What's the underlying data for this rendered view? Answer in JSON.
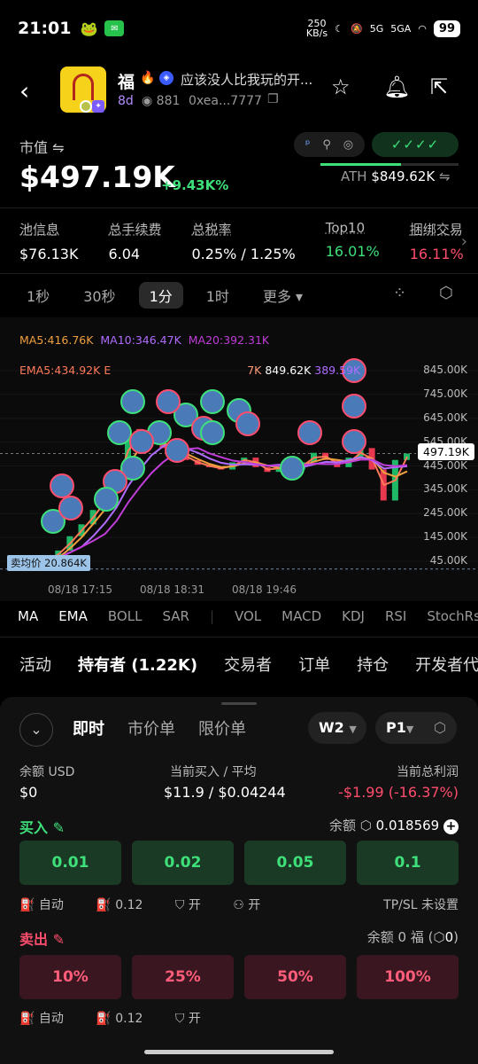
{
  "status": {
    "time": "21:01",
    "net_speed_top": "250",
    "net_speed_unit": "KB/s",
    "signal1": "5G",
    "signal2": "5GA",
    "battery": "99"
  },
  "token": {
    "name": "福",
    "description": "应该没人比我玩的开...",
    "age": "8d",
    "views": "881",
    "address": "0xea...7777"
  },
  "market": {
    "label": "市值",
    "value": "$497.19K",
    "change": "+9.43K%",
    "ath_label": "ATH",
    "ath_value": "$849.62K",
    "ath_progress": 0.585,
    "checks": "✓✓✓✓"
  },
  "stats": [
    {
      "label": "池信息",
      "value": "$76.13K",
      "color": "#ffffff"
    },
    {
      "label": "总手续费",
      "value": "6.04",
      "color": "#ffffff"
    },
    {
      "label": "总税率",
      "value": "0.25% / 1.25%",
      "color": "#ffffff"
    },
    {
      "label": "Top10",
      "value": "16.01%",
      "color": "#3ee07a"
    },
    {
      "label": "捆绑交易",
      "value": "16.11%",
      "color": "#ff4d6d"
    }
  ],
  "timeframes": [
    "1秒",
    "30秒",
    "1分",
    "1时",
    "更多"
  ],
  "active_timeframe": "1分",
  "chart_data": {
    "type": "line",
    "ma_legend": {
      "ma5": "MA5:416.76K",
      "ma10": "MA10:346.47K",
      "ma20": "MA20:392.31K"
    },
    "ema_legend": {
      "ema5": "EMA5:434.92K",
      "ema_rest": "E",
      "ath_marker": "849.62K",
      "ema20": "389.59K",
      "ema_mid": "7K"
    },
    "y_ticks": [
      "845.00K",
      "745.00K",
      "645.00K",
      "545.00K",
      "445.00K",
      "345.00K",
      "245.00K",
      "145.00K",
      "45.00K"
    ],
    "x_ticks": [
      "08/18 17:15",
      "08/18 18:31",
      "08/18 19:46"
    ],
    "sell_avg": "卖均价 20.864K",
    "current_price": "497.19K",
    "price_series": [
      30,
      60,
      90,
      150,
      200,
      260,
      330,
      420,
      600,
      540,
      560,
      520,
      500,
      470,
      450,
      440,
      430,
      460,
      480,
      440,
      420,
      450,
      430,
      460,
      500,
      470,
      440,
      480,
      520,
      430,
      300,
      470,
      497
    ],
    "colors": {
      "ma5": "#f0a040",
      "ma10": "#b06cff",
      "ma20": "#c03dd8",
      "ema5": "#ff7a59"
    }
  },
  "indicators": [
    "MA",
    "EMA",
    "BOLL",
    "SAR",
    "VOL",
    "MACD",
    "KDJ",
    "RSI",
    "StochRsi"
  ],
  "tabs": [
    "活动",
    "持有者 (1.22K)",
    "交易者",
    "订单",
    "持仓",
    "开发者代币"
  ],
  "order": {
    "tabs": [
      "即时",
      "市价单",
      "限价单"
    ],
    "wallet": "W2",
    "preset": "P1",
    "balance_label": "余额 USD",
    "balance_value": "$0",
    "current_buy_label": "当前买入 / 平均",
    "current_buy_value": "$11.9 / $0.04244",
    "pnl_label": "当前总利润",
    "pnl_value": "-$1.99 (-16.37%)",
    "buy_label": "买入",
    "buy_balance_label": "余额",
    "buy_balance_value": "0.018569",
    "buy_amounts": [
      "0.01",
      "0.02",
      "0.05",
      "0.1"
    ],
    "auto_label": "自动",
    "gas": "0.12",
    "on_label": "开",
    "tpsl": "TP/SL 未设置",
    "sell_label": "卖出",
    "sell_balance": "余额 0 福",
    "sell_balance_extra": "0",
    "sell_amounts": [
      "10%",
      "25%",
      "50%",
      "100%"
    ]
  }
}
